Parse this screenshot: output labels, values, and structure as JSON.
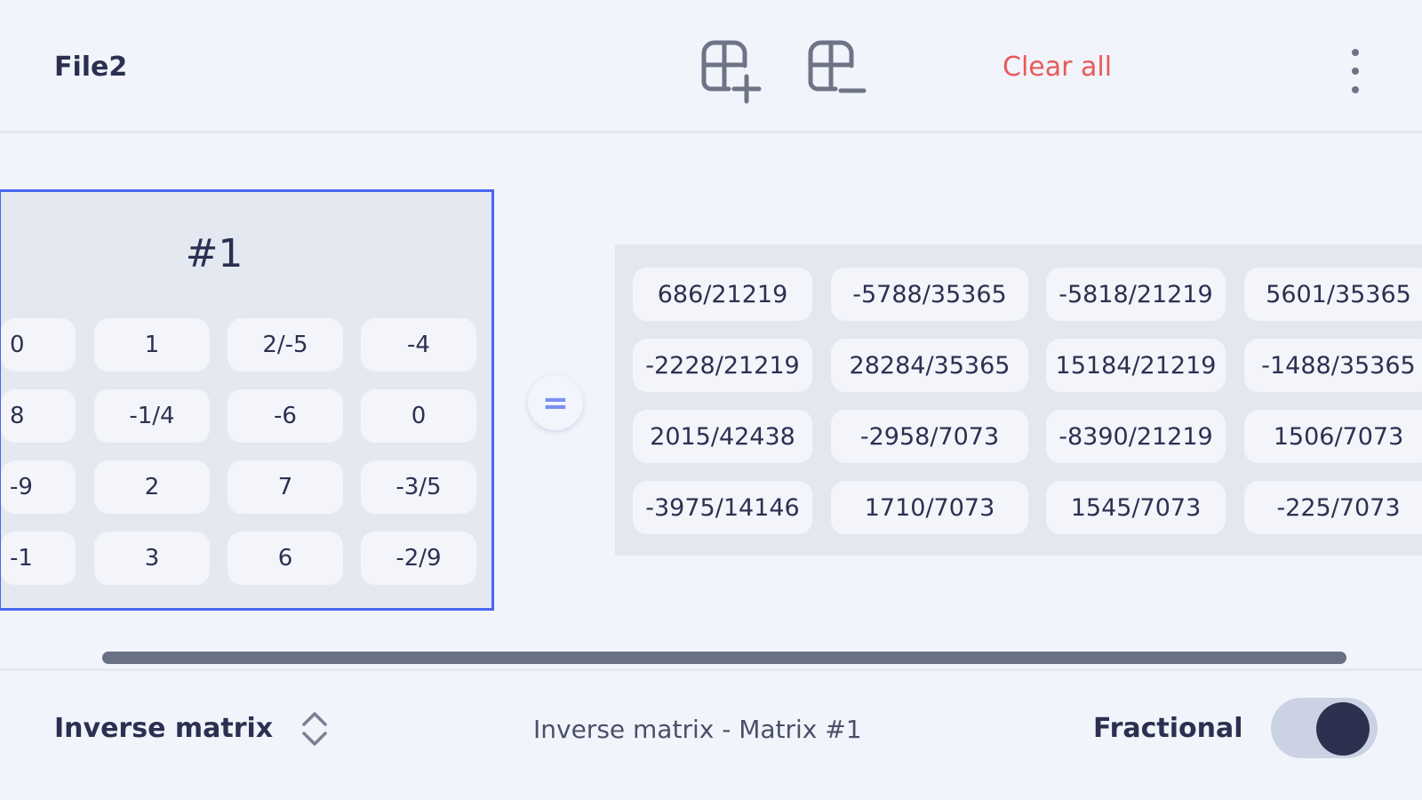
{
  "header": {
    "file_title": "File2",
    "add_matrix_icon": "add-matrix-icon",
    "remove_matrix_icon": "remove-matrix-icon",
    "clear_all_label": "Clear all",
    "more_icon": "more-vertical-icon",
    "clear_all_color": "#e85a58"
  },
  "matrix": {
    "label": "#1",
    "rows": [
      [
        "0",
        "1",
        "2/-5",
        "-4"
      ],
      [
        "8",
        "-1/4",
        "-6",
        "0"
      ],
      [
        "-9",
        "2",
        "7",
        "-3/5"
      ],
      [
        "-1",
        "3",
        "6",
        "-2/9"
      ]
    ],
    "border_color": "#4b68f0"
  },
  "equals": {
    "label": "="
  },
  "result": {
    "rows": [
      [
        "686/21219",
        "-5788/35365",
        "-5818/21219",
        "5601/35365"
      ],
      [
        "-2228/21219",
        "28284/35365",
        "15184/21219",
        "-1488/35365"
      ],
      [
        "2015/42438",
        "-2958/7073",
        "-8390/21219",
        "1506/7073"
      ],
      [
        "-3975/14146",
        "1710/7073",
        "1545/7073",
        "-225/7073"
      ]
    ]
  },
  "footer": {
    "operation_label": "Inverse matrix",
    "operation_icon": "chevron-up-down-icon",
    "operation_description": "Inverse matrix - Matrix #1",
    "fractional_label": "Fractional",
    "fractional_on": true
  }
}
